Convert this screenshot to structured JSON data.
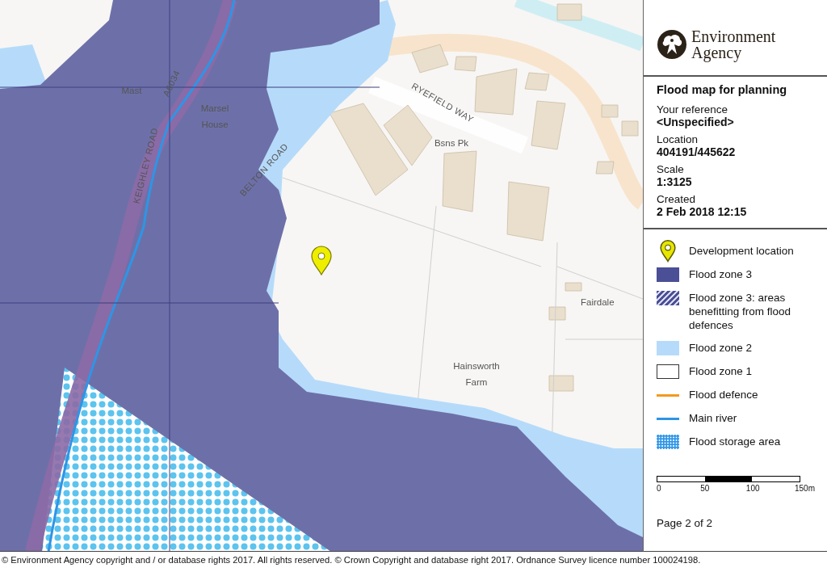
{
  "map": {
    "labels": [
      {
        "text": "Mast",
        "kind": "place"
      },
      {
        "text": "A6034",
        "kind": "road"
      },
      {
        "text": "Marsel House",
        "kind": "place"
      },
      {
        "text": "KEIGHLEY ROAD",
        "kind": "road"
      },
      {
        "text": "BELTON ROAD",
        "kind": "road"
      },
      {
        "text": "RYEFIELD WAY",
        "kind": "road"
      },
      {
        "text": "Bsns Pk",
        "kind": "place"
      },
      {
        "text": "Fairdale",
        "kind": "place"
      },
      {
        "text": "Hainsworth Farm",
        "kind": "place"
      }
    ]
  },
  "sidebar": {
    "logo_text": [
      "Environment",
      "Agency"
    ],
    "title": "Flood map for planning",
    "fields": [
      {
        "label": "Your reference",
        "value": "<Unspecified>"
      },
      {
        "label": "Location",
        "value": "404191/445622"
      },
      {
        "label": "Scale",
        "value": "1:3125"
      },
      {
        "label": "Created",
        "value": "2 Feb 2018 12:15"
      }
    ],
    "legend": [
      {
        "kind": "pin",
        "label": "Development location",
        "color": "#e6e600"
      },
      {
        "kind": "fill",
        "label": "Flood zone 3",
        "color": "#4a4f96"
      },
      {
        "kind": "hatch",
        "label": "Flood zone 3: areas benefitting from flood defences",
        "color": "#4a4f96"
      },
      {
        "kind": "fill",
        "label": "Flood zone 2",
        "color": "#b6dbfa"
      },
      {
        "kind": "outline",
        "label": "Flood zone 1",
        "color": "#333333"
      },
      {
        "kind": "line",
        "label": "Flood defence",
        "color": "#f39a1e"
      },
      {
        "kind": "line",
        "label": "Main river",
        "color": "#2e95e6"
      },
      {
        "kind": "dots",
        "label": "Flood storage area",
        "color": "#2e95e6"
      }
    ],
    "scale_labels": [
      "0",
      "50",
      "100",
      "150m"
    ],
    "page": "Page 2 of 2"
  },
  "footer": "© Environment Agency copyright and / or database rights 2017. All rights reserved. © Crown Copyright and database right 2017. Ordnance Survey licence number 100024198."
}
